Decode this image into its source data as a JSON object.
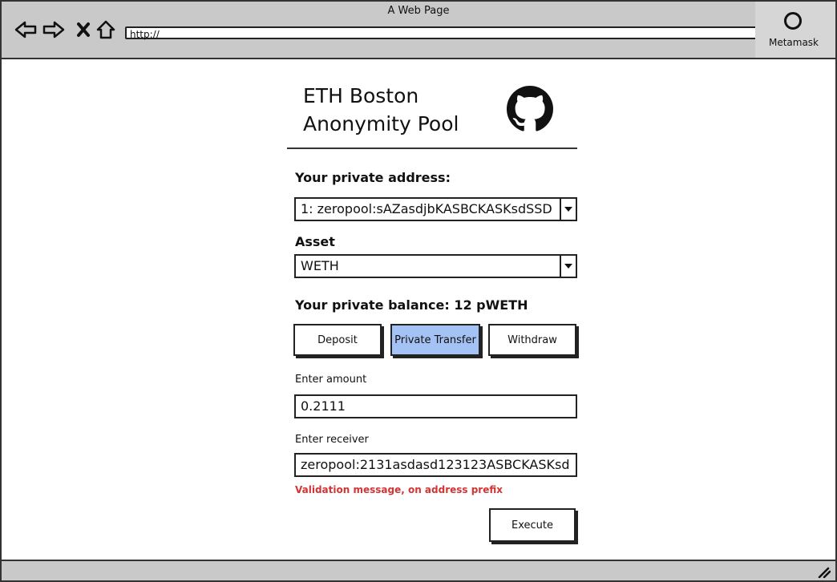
{
  "window": {
    "title": "A Web Page",
    "url": "http://"
  },
  "metamask": {
    "label": "Metamask"
  },
  "header": {
    "title_line1": "ETH Boston",
    "title_line2": "Anonymity Pool",
    "logo_icon": "github-icon"
  },
  "private_address": {
    "label": "Your private address:",
    "selected": "1: zeropool:sAZasdjbKASBCKASKsdSSD"
  },
  "asset": {
    "label": "Asset",
    "selected": "WETH"
  },
  "balance": {
    "text": "Your private balance: 12 pWETH"
  },
  "tabs": [
    {
      "label": "Deposit",
      "active": false
    },
    {
      "label": "Private Transfer",
      "active": true
    },
    {
      "label": "Withdraw",
      "active": false
    }
  ],
  "amount": {
    "label": "Enter amount",
    "value": "0.2111"
  },
  "receiver": {
    "label": "Enter receiver",
    "value": "zeropool:2131asdasd123123ASBCKASKsd"
  },
  "validation": {
    "message": "Validation message, on address prefix",
    "color": "#d23434"
  },
  "execute": {
    "label": "Execute"
  },
  "colors": {
    "active_tab": "#a4c2f4",
    "chrome": "#c9c9c9"
  }
}
